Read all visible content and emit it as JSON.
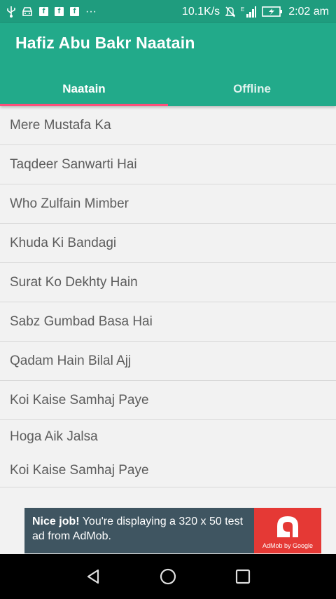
{
  "status_bar": {
    "speed": "10.1K/s",
    "time": "2:02 am",
    "icons": [
      "usb-icon",
      "car-icon",
      "facebook-icon",
      "facebook-icon",
      "facebook-icon",
      "more-icon",
      "mute-icon",
      "signal-icon",
      "battery-charging-icon"
    ],
    "fb_glyph": "f",
    "more_glyph": "···",
    "signal_label": "E"
  },
  "app": {
    "title": "Hafiz Abu Bakr Naatain"
  },
  "tabs": [
    {
      "label": "Naatain",
      "selected": true
    },
    {
      "label": "Offline",
      "selected": false
    }
  ],
  "list": {
    "items": [
      "Mere Mustafa Ka",
      "Taqdeer Sanwarti Hai",
      "Who Zulfain Mimber",
      "Khuda Ki Bandagi",
      "Surat Ko Dekhty Hain",
      "Sabz Gumbad Basa Hai",
      "Qadam Hain Bilal Ajj",
      "Koi Kaise Samhaj Paye",
      "Hoga Aik Jalsa",
      "Koi Kaise Samhaj Paye"
    ]
  },
  "ad": {
    "bold": "Nice job!",
    "text": " You're displaying a 320 x 50 test ad from AdMob.",
    "logo_text": "AdMob by Google"
  },
  "nav": {
    "buttons": [
      "back-icon",
      "home-icon",
      "recents-icon"
    ]
  },
  "colors": {
    "status_bar": "#1f9c7e",
    "app_bar": "#22aa8a",
    "tab_indicator": "#ff4f7b",
    "ad_background": "#3f5561",
    "ad_logo": "#e53935"
  }
}
